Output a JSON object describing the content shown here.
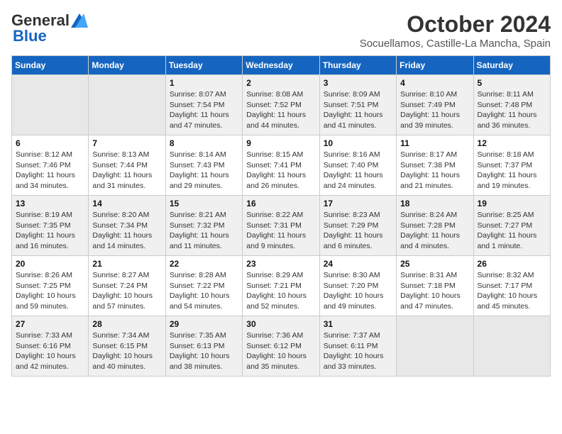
{
  "header": {
    "logo_general": "General",
    "logo_blue": "Blue",
    "month_title": "October 2024",
    "subtitle": "Socuellamos, Castille-La Mancha, Spain"
  },
  "weekdays": [
    "Sunday",
    "Monday",
    "Tuesday",
    "Wednesday",
    "Thursday",
    "Friday",
    "Saturday"
  ],
  "weeks": [
    [
      {
        "day": "",
        "empty": true
      },
      {
        "day": "",
        "empty": true
      },
      {
        "day": "1",
        "sunrise": "8:07 AM",
        "sunset": "7:54 PM",
        "daylight": "11 hours and 47 minutes."
      },
      {
        "day": "2",
        "sunrise": "8:08 AM",
        "sunset": "7:52 PM",
        "daylight": "11 hours and 44 minutes."
      },
      {
        "day": "3",
        "sunrise": "8:09 AM",
        "sunset": "7:51 PM",
        "daylight": "11 hours and 41 minutes."
      },
      {
        "day": "4",
        "sunrise": "8:10 AM",
        "sunset": "7:49 PM",
        "daylight": "11 hours and 39 minutes."
      },
      {
        "day": "5",
        "sunrise": "8:11 AM",
        "sunset": "7:48 PM",
        "daylight": "11 hours and 36 minutes."
      }
    ],
    [
      {
        "day": "6",
        "sunrise": "8:12 AM",
        "sunset": "7:46 PM",
        "daylight": "11 hours and 34 minutes."
      },
      {
        "day": "7",
        "sunrise": "8:13 AM",
        "sunset": "7:44 PM",
        "daylight": "11 hours and 31 minutes."
      },
      {
        "day": "8",
        "sunrise": "8:14 AM",
        "sunset": "7:43 PM",
        "daylight": "11 hours and 29 minutes."
      },
      {
        "day": "9",
        "sunrise": "8:15 AM",
        "sunset": "7:41 PM",
        "daylight": "11 hours and 26 minutes."
      },
      {
        "day": "10",
        "sunrise": "8:16 AM",
        "sunset": "7:40 PM",
        "daylight": "11 hours and 24 minutes."
      },
      {
        "day": "11",
        "sunrise": "8:17 AM",
        "sunset": "7:38 PM",
        "daylight": "11 hours and 21 minutes."
      },
      {
        "day": "12",
        "sunrise": "8:18 AM",
        "sunset": "7:37 PM",
        "daylight": "11 hours and 19 minutes."
      }
    ],
    [
      {
        "day": "13",
        "sunrise": "8:19 AM",
        "sunset": "7:35 PM",
        "daylight": "11 hours and 16 minutes."
      },
      {
        "day": "14",
        "sunrise": "8:20 AM",
        "sunset": "7:34 PM",
        "daylight": "11 hours and 14 minutes."
      },
      {
        "day": "15",
        "sunrise": "8:21 AM",
        "sunset": "7:32 PM",
        "daylight": "11 hours and 11 minutes."
      },
      {
        "day": "16",
        "sunrise": "8:22 AM",
        "sunset": "7:31 PM",
        "daylight": "11 hours and 9 minutes."
      },
      {
        "day": "17",
        "sunrise": "8:23 AM",
        "sunset": "7:29 PM",
        "daylight": "11 hours and 6 minutes."
      },
      {
        "day": "18",
        "sunrise": "8:24 AM",
        "sunset": "7:28 PM",
        "daylight": "11 hours and 4 minutes."
      },
      {
        "day": "19",
        "sunrise": "8:25 AM",
        "sunset": "7:27 PM",
        "daylight": "11 hours and 1 minute."
      }
    ],
    [
      {
        "day": "20",
        "sunrise": "8:26 AM",
        "sunset": "7:25 PM",
        "daylight": "10 hours and 59 minutes."
      },
      {
        "day": "21",
        "sunrise": "8:27 AM",
        "sunset": "7:24 PM",
        "daylight": "10 hours and 57 minutes."
      },
      {
        "day": "22",
        "sunrise": "8:28 AM",
        "sunset": "7:22 PM",
        "daylight": "10 hours and 54 minutes."
      },
      {
        "day": "23",
        "sunrise": "8:29 AM",
        "sunset": "7:21 PM",
        "daylight": "10 hours and 52 minutes."
      },
      {
        "day": "24",
        "sunrise": "8:30 AM",
        "sunset": "7:20 PM",
        "daylight": "10 hours and 49 minutes."
      },
      {
        "day": "25",
        "sunrise": "8:31 AM",
        "sunset": "7:18 PM",
        "daylight": "10 hours and 47 minutes."
      },
      {
        "day": "26",
        "sunrise": "8:32 AM",
        "sunset": "7:17 PM",
        "daylight": "10 hours and 45 minutes."
      }
    ],
    [
      {
        "day": "27",
        "sunrise": "7:33 AM",
        "sunset": "6:16 PM",
        "daylight": "10 hours and 42 minutes."
      },
      {
        "day": "28",
        "sunrise": "7:34 AM",
        "sunset": "6:15 PM",
        "daylight": "10 hours and 40 minutes."
      },
      {
        "day": "29",
        "sunrise": "7:35 AM",
        "sunset": "6:13 PM",
        "daylight": "10 hours and 38 minutes."
      },
      {
        "day": "30",
        "sunrise": "7:36 AM",
        "sunset": "6:12 PM",
        "daylight": "10 hours and 35 minutes."
      },
      {
        "day": "31",
        "sunrise": "7:37 AM",
        "sunset": "6:11 PM",
        "daylight": "10 hours and 33 minutes."
      },
      {
        "day": "",
        "empty": true
      },
      {
        "day": "",
        "empty": true
      }
    ]
  ]
}
